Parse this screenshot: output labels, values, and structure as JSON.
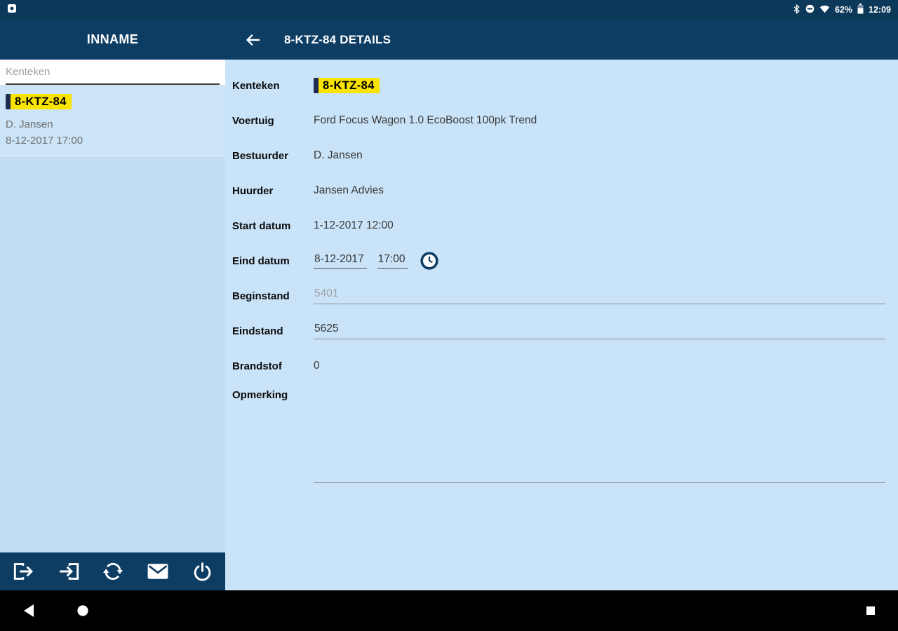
{
  "status_bar": {
    "battery_percent": "62%",
    "time": "12:09",
    "icons": [
      "notification-icon",
      "bluetooth-icon",
      "do-not-disturb-icon",
      "wifi-icon",
      "battery-icon"
    ]
  },
  "app_bar": {
    "left_title": "INNAME",
    "title": "8-KTZ-84 DETAILS",
    "back_icon": "arrow-back-icon"
  },
  "sidebar": {
    "search_placeholder": "Kenteken",
    "item": {
      "plate": "8-KTZ-84",
      "driver": "D. Jansen",
      "datetime": "8-12-2017 17:00"
    },
    "toolbar_icons": [
      "logout-icon",
      "login-icon",
      "sync-icon",
      "mail-icon",
      "power-icon"
    ]
  },
  "form": {
    "kenteken": {
      "label": "Kenteken",
      "plate": "8-KTZ-84"
    },
    "voertuig": {
      "label": "Voertuig",
      "value": "Ford Focus Wagon 1.0 EcoBoost 100pk Trend"
    },
    "bestuurder": {
      "label": "Bestuurder",
      "value": "D. Jansen"
    },
    "huurder": {
      "label": "Huurder",
      "value": "Jansen Advies"
    },
    "start_datum": {
      "label": "Start datum",
      "value": "1-12-2017 12:00"
    },
    "eind_datum": {
      "label": "Eind datum",
      "date": "8-12-2017",
      "time": "17:00",
      "picker_icon": "clock-icon"
    },
    "beginstand": {
      "label": "Beginstand",
      "placeholder": "5401"
    },
    "eindstand": {
      "label": "Eindstand",
      "value": "5625"
    },
    "brandstof": {
      "label": "Brandstof",
      "value": "0"
    },
    "opmerking": {
      "label": "Opmerking",
      "value": ""
    }
  },
  "nav_bar": {
    "icons": [
      "back-triangle-icon",
      "home-circle-icon",
      "square-icon"
    ]
  },
  "colors": {
    "app_bar_navy": "#0e3d64",
    "status_bar_navy": "#0c3859",
    "sidebar_blue": "#c3def3",
    "main_blue": "#c9e3f8",
    "plate_yellow": "#f9e300",
    "plate_strip_blue": "#1d2b52"
  }
}
